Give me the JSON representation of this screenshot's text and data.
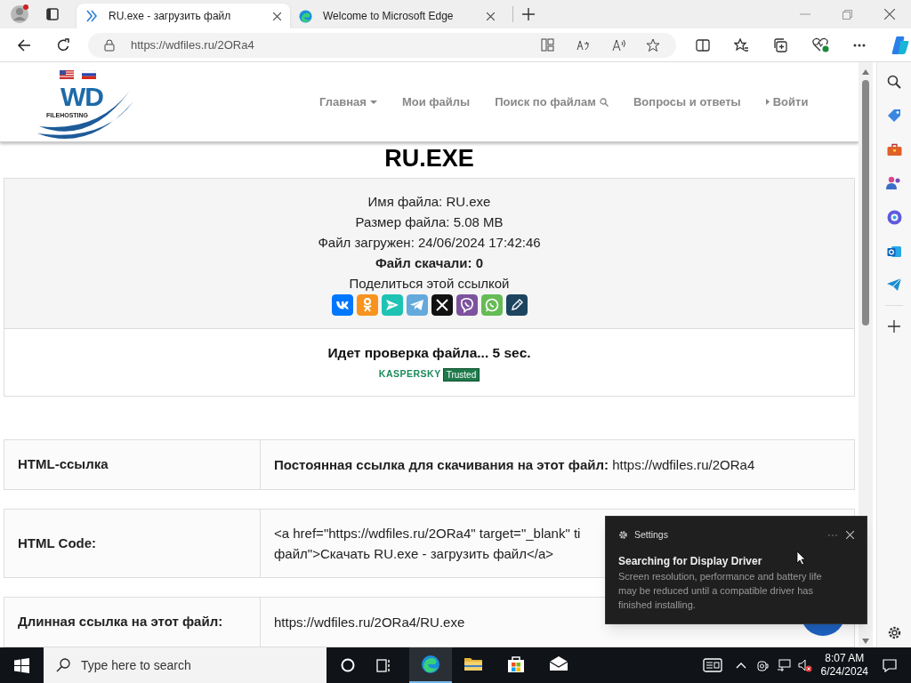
{
  "browser": {
    "tabs": [
      {
        "title": "RU.exe - загрузить файл",
        "selected": true
      },
      {
        "title": "Welcome to Microsoft Edge",
        "selected": false
      }
    ],
    "url": "https://wdfiles.ru/2ORa4"
  },
  "site": {
    "logo": {
      "mark": "WD",
      "sub": "FILEHOSTING"
    },
    "nav": [
      {
        "label": "Главная",
        "kind": "dropdown"
      },
      {
        "label": "Мои файлы",
        "kind": "plain"
      },
      {
        "label": "Поиск по файлам",
        "kind": "search"
      },
      {
        "label": "Вопросы и ответы",
        "kind": "plain"
      },
      {
        "label": "Войти",
        "kind": "login"
      }
    ]
  },
  "file": {
    "title": "RU.EXE",
    "info": [
      {
        "text": "Имя файла: RU.exe",
        "bold": false
      },
      {
        "text": "Размер файла: 5.08 MB",
        "bold": false
      },
      {
        "text": "Файл загружен: 24/06/2024 17:42:46",
        "bold": false
      },
      {
        "text": "Файл скачали: 0",
        "bold": true
      }
    ],
    "share_label": "Поделиться этой ссылкой",
    "share": [
      {
        "kind": "vk",
        "color": "#0077ff"
      },
      {
        "kind": "ok",
        "color": "#f7931e"
      },
      {
        "kind": "send",
        "color": "#1fc3b3"
      },
      {
        "kind": "telegram",
        "color": "#64a9dc"
      },
      {
        "kind": "x",
        "color": "#111111"
      },
      {
        "kind": "viber",
        "color": "#7c529e"
      },
      {
        "kind": "whatsapp",
        "color": "#65bc54"
      },
      {
        "kind": "pencil",
        "color": "#1e4560"
      }
    ],
    "check": "Идет проверка файла... 5 sec.",
    "badge": {
      "brand": "KASPERSKY",
      "status": "Trusted"
    }
  },
  "links": [
    {
      "label": "HTML-ссылка",
      "lines": [
        "**Постоянная ссылка для скачивания на этот файл:** https://wdfiles.ru/2ORa4"
      ]
    },
    {
      "label": "HTML Code:",
      "lines": [
        "<a href=\"https://wdfiles.ru/2ORa4\" target=\"_blank\" ti",
        "файл\">Скачать RU.exe - загрузить файл</a>"
      ]
    },
    {
      "label": "Длинная ссылка на этот файл:",
      "lines": [
        "https://wdfiles.ru/2ORa4/RU.exe"
      ]
    }
  ],
  "notification": {
    "app": "Settings",
    "title": "Searching for Display Driver",
    "body": "Screen resolution, performance and battery life may be reduced until a compatible driver has finished installing."
  },
  "taskbar": {
    "search_placeholder": "Type here to search",
    "apps": [
      {
        "kind": "edge",
        "selected": true
      },
      {
        "kind": "folder",
        "selected": false
      },
      {
        "kind": "store",
        "selected": false
      },
      {
        "kind": "mail",
        "selected": false
      }
    ],
    "time": "8:07 AM",
    "date": "6/24/2024"
  }
}
